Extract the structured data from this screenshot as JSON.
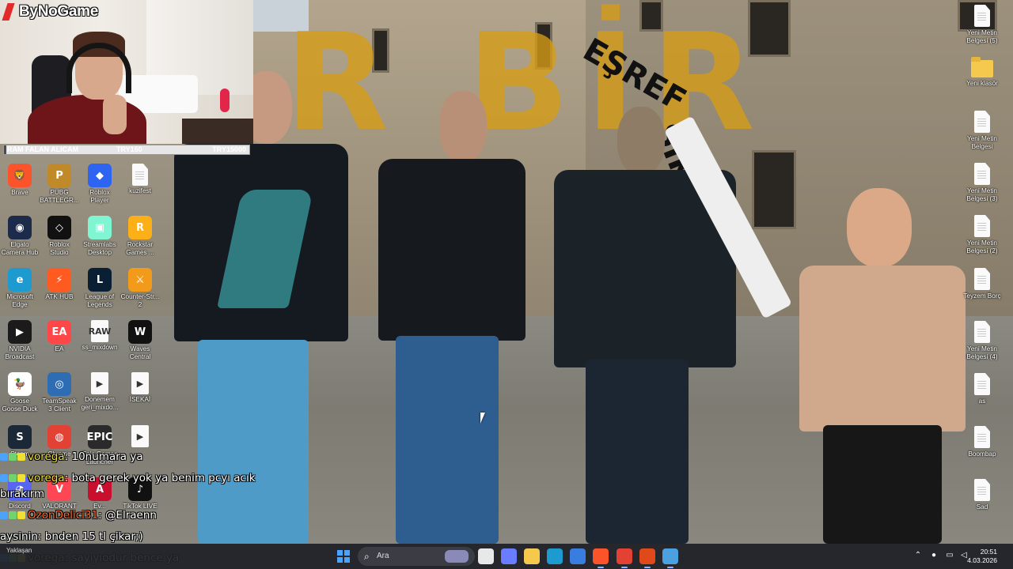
{
  "stream": {
    "brand": "ByNoGame",
    "goal": {
      "name": "RAM FALAN ALICAM",
      "current": "TRY160",
      "target": "TRY15000",
      "progress": 0.0107
    }
  },
  "wallpaper": {
    "title_text": "R BİR",
    "rotated_text_1": "EŞREF",
    "rotated_text_2": "SİK"
  },
  "desktop_left": [
    {
      "label": "Brave",
      "icon": "brave-icon",
      "color": "#fb542b",
      "glyph": "🦁"
    },
    {
      "label": "PUBG BATTLEGR...",
      "icon": "pubg-icon",
      "color": "#c08a2a",
      "glyph": "P"
    },
    {
      "label": "Roblox Player",
      "icon": "roblox-icon",
      "color": "#2d64f2",
      "glyph": "◆"
    },
    {
      "label": "kuzifest",
      "icon": "document-icon",
      "color": "#fafafa",
      "glyph": ""
    },
    {
      "label": "Elgato Camera Hub",
      "icon": "elgato-icon",
      "color": "#1c2b4a",
      "glyph": "◉"
    },
    {
      "label": "Roblox Studio",
      "icon": "roblox-studio-icon",
      "color": "#111111",
      "glyph": "◇"
    },
    {
      "label": "Streamlabs Desktop",
      "icon": "streamlabs-icon",
      "color": "#80f5d2",
      "glyph": "▣"
    },
    {
      "label": "Rockstar Games ...",
      "icon": "rockstar-icon",
      "color": "#fcaf17",
      "glyph": "R"
    },
    {
      "label": "Microsoft Edge",
      "icon": "edge-icon",
      "color": "#1d9bd1",
      "glyph": "e"
    },
    {
      "label": "ATK HUB",
      "icon": "atk-hub-icon",
      "color": "#ff5a1f",
      "glyph": "⚡"
    },
    {
      "label": "League of Legends",
      "icon": "league-icon",
      "color": "#0a1f33",
      "glyph": "L"
    },
    {
      "label": "Counter-Str... 2",
      "icon": "counter-strike-icon",
      "color": "#f29a1a",
      "glyph": "⚔"
    },
    {
      "label": "NVIDIA Broadcast",
      "icon": "nvidia-icon",
      "color": "#1b1b1b",
      "glyph": "▶"
    },
    {
      "label": "EA",
      "icon": "ea-icon",
      "color": "#ff4747",
      "glyph": "EA"
    },
    {
      "label": "ss_mixdown",
      "icon": "audio-file-icon",
      "color": "#fafafa",
      "glyph": "RAW"
    },
    {
      "label": "Waves Central",
      "icon": "waves-icon",
      "color": "#111111",
      "glyph": "W"
    },
    {
      "label": "Goose Goose Duck",
      "icon": "goose-icon",
      "color": "#ffffff",
      "glyph": "🦆"
    },
    {
      "label": "TeamSpeak 3 Client",
      "icon": "teamspeak-icon",
      "color": "#2e6db4",
      "glyph": "◎"
    },
    {
      "label": "Donemem geri_mixdo...",
      "icon": "video-file-icon",
      "color": "#fafafa",
      "glyph": "▶"
    },
    {
      "label": "İSEKAİ",
      "icon": "video-file-icon",
      "color": "#fafafa",
      "glyph": "▶"
    },
    {
      "label": "Steam",
      "icon": "steam-icon",
      "color": "#1b2838",
      "glyph": "S"
    },
    {
      "label": "Chrome",
      "icon": "chrome-icon",
      "color": "#e34133",
      "glyph": "◍"
    },
    {
      "label": "Epic Games Launcher",
      "icon": "epic-icon",
      "color": "#2a2a2a",
      "glyph": "EPIC"
    },
    {
      "label": "",
      "icon": "video-file-icon",
      "color": "#fafafa",
      "glyph": "▶"
    },
    {
      "label": "Discord",
      "icon": "discord-icon",
      "color": "#5865f2",
      "glyph": "◕"
    },
    {
      "label": "VALORANT",
      "icon": "valorant-icon",
      "color": "#ff4655",
      "glyph": "V"
    },
    {
      "label": "Ev...",
      "icon": "app-icon",
      "color": "#c8102e",
      "glyph": "A"
    },
    {
      "label": "TikTok LIVE",
      "icon": "tiktok-icon",
      "color": "#111111",
      "glyph": "♪"
    }
  ],
  "desktop_right": [
    {
      "label": "Yeni Metin Belgesi (5)",
      "icon": "document-icon"
    },
    {
      "label": "Yeni klasör",
      "icon": "folder-icon"
    },
    {
      "label": "Yeni Metin Belgesi",
      "icon": "document-icon"
    },
    {
      "label": "Yeni Metin Belgesi (3)",
      "icon": "document-icon"
    },
    {
      "label": "Yeni Metin Belgesi (2)",
      "icon": "document-icon"
    },
    {
      "label": "Teyzem Borç",
      "icon": "document-icon"
    },
    {
      "label": "Yeni Metin Belgesi (4)",
      "icon": "document-icon"
    },
    {
      "label": "as",
      "icon": "document-icon"
    },
    {
      "label": "Boombap",
      "icon": "document-icon"
    },
    {
      "label": "Sad",
      "icon": "document-icon"
    }
  ],
  "chat": [
    {
      "user": "vorega",
      "message": "10numara ya",
      "user_color": "#f0e030",
      "badges": true
    },
    {
      "user": "vorega",
      "message": "bota gerek yok ya benim pcyı acık",
      "user_color": "#f0e030",
      "badges": true
    },
    {
      "user": "",
      "message": "bırakırm",
      "user_color": "#ffffff",
      "badges": false
    },
    {
      "user": "OzonDelici31",
      "message": "@Elraenn",
      "user_color": "#ff6a2a",
      "badges": true
    },
    {
      "user": "aysinin",
      "message": "bnden 15 tl çikar;)",
      "user_color": "#ffffff",
      "badges": false
    },
    {
      "user": "vorega",
      "message": "sayıyıodur bence ya",
      "user_color": "#f0e030",
      "badges": true
    }
  ],
  "taskbar": {
    "weather_label": "Yaklaşan",
    "search_placeholder": "Ara",
    "apps": [
      {
        "icon": "task-view-icon",
        "color": "#e8e8e8"
      },
      {
        "icon": "copilot-icon",
        "color": "#6a7cff"
      },
      {
        "icon": "file-explorer-icon",
        "color": "#f4c94e"
      },
      {
        "icon": "edge-icon",
        "color": "#1d9bd1"
      },
      {
        "icon": "microsoft-store-icon",
        "color": "#3a7de0"
      },
      {
        "icon": "brave-icon",
        "color": "#fb542b"
      },
      {
        "icon": "chrome-icon",
        "color": "#e34133"
      },
      {
        "icon": "streamlabs-icon",
        "color": "#e04a1a"
      },
      {
        "icon": "app-icon",
        "color": "#4ba0e0"
      }
    ],
    "time": "20:51",
    "date": "4.03.2026"
  }
}
